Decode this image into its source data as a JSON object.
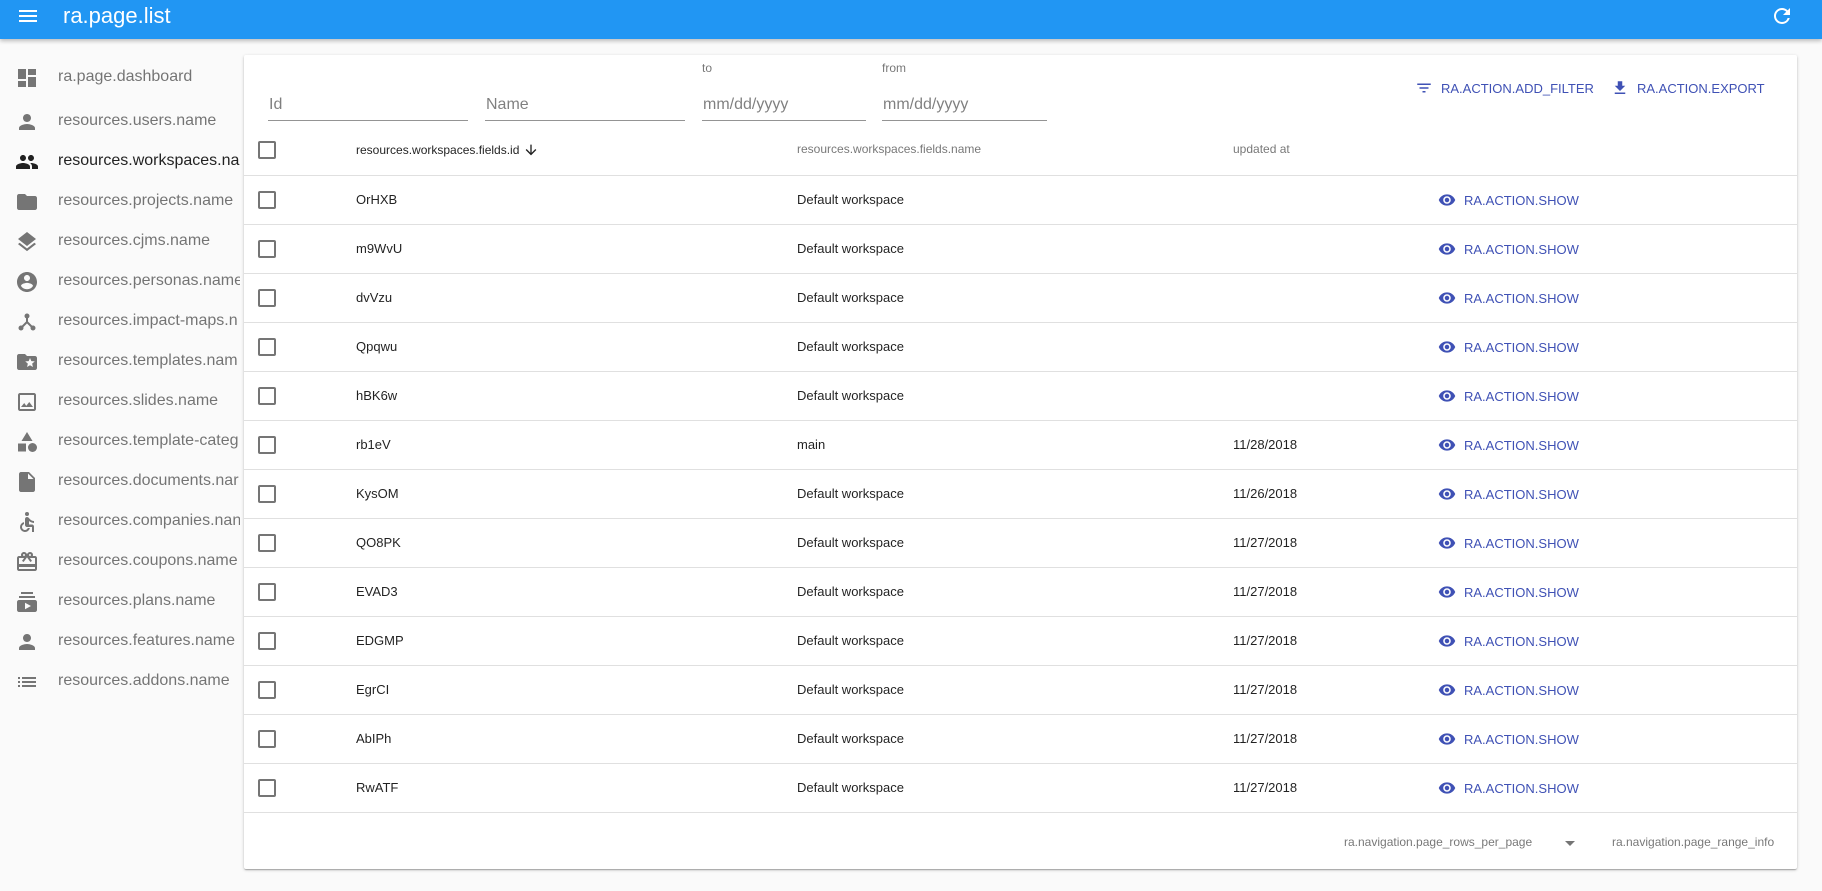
{
  "appbar": {
    "title": "ra.page.list",
    "menu_icon": "menu-icon",
    "refresh_icon": "refresh-icon",
    "color": "#2196f3"
  },
  "sidebar": {
    "items": [
      {
        "label": "ra.page.dashboard",
        "icon": "dashboard-icon"
      },
      {
        "label": "resources.users.name",
        "icon": "person-icon"
      },
      {
        "label": "resources.workspaces.na",
        "icon": "people-icon",
        "active": true
      },
      {
        "label": "resources.projects.name",
        "icon": "folder-icon"
      },
      {
        "label": "resources.cjms.name",
        "icon": "layers-icon"
      },
      {
        "label": "resources.personas.name",
        "icon": "account-circle-icon"
      },
      {
        "label": "resources.impact-maps.n",
        "icon": "tree-icon"
      },
      {
        "label": "resources.templates.nam",
        "icon": "folder-star-icon"
      },
      {
        "label": "resources.slides.name",
        "icon": "image-frame-icon"
      },
      {
        "label": "resources.template-categ",
        "icon": "category-icon"
      },
      {
        "label": "resources.documents.nar",
        "icon": "document-icon"
      },
      {
        "label": "resources.companies.nan",
        "icon": "accessible-icon"
      },
      {
        "label": "resources.coupons.name",
        "icon": "card-giftcard-icon"
      },
      {
        "label": "resources.plans.name",
        "icon": "subscriptions-icon"
      },
      {
        "label": "resources.features.name",
        "icon": "person-icon"
      },
      {
        "label": "resources.addons.name",
        "icon": "list-icon"
      }
    ]
  },
  "filters": {
    "id": {
      "placeholder": "Id"
    },
    "name": {
      "placeholder": "Name"
    },
    "to": {
      "label": "to",
      "placeholder": "mm/dd/yyyy"
    },
    "from": {
      "label": "from",
      "placeholder": "mm/dd/yyyy"
    }
  },
  "actions": {
    "add_filter": "RA.ACTION.ADD_FILTER",
    "export": "RA.ACTION.EXPORT",
    "accent": "#3f51b5"
  },
  "table": {
    "headers": {
      "id": "resources.workspaces.fields.id",
      "name": "resources.workspaces.fields.name",
      "updated_at": "updated at",
      "sort_icon": "arrow-downward-icon"
    },
    "show_label": "RA.ACTION.SHOW",
    "rows": [
      {
        "id": "OrHXB",
        "name": "Default workspace",
        "updated_at": ""
      },
      {
        "id": "m9WvU",
        "name": "Default workspace",
        "updated_at": ""
      },
      {
        "id": "dvVzu",
        "name": "Default workspace",
        "updated_at": ""
      },
      {
        "id": "Qpqwu",
        "name": "Default workspace",
        "updated_at": ""
      },
      {
        "id": "hBK6w",
        "name": "Default workspace",
        "updated_at": ""
      },
      {
        "id": "rb1eV",
        "name": "main",
        "updated_at": "11/28/2018"
      },
      {
        "id": "KysOM",
        "name": "Default workspace",
        "updated_at": "11/26/2018"
      },
      {
        "id": "QO8PK",
        "name": "Default workspace",
        "updated_at": "11/27/2018"
      },
      {
        "id": "EVAD3",
        "name": "Default workspace",
        "updated_at": "11/27/2018"
      },
      {
        "id": "EDGMP",
        "name": "Default workspace",
        "updated_at": "11/27/2018"
      },
      {
        "id": "EgrCI",
        "name": "Default workspace",
        "updated_at": "11/27/2018"
      },
      {
        "id": "AbIPh",
        "name": "Default workspace",
        "updated_at": "11/27/2018"
      },
      {
        "id": "RwATF",
        "name": "Default workspace",
        "updated_at": "11/27/2018"
      }
    ]
  },
  "pagination": {
    "rows_per_page_label": "ra.navigation.page_rows_per_page",
    "range_info": "ra.navigation.page_range_info"
  }
}
